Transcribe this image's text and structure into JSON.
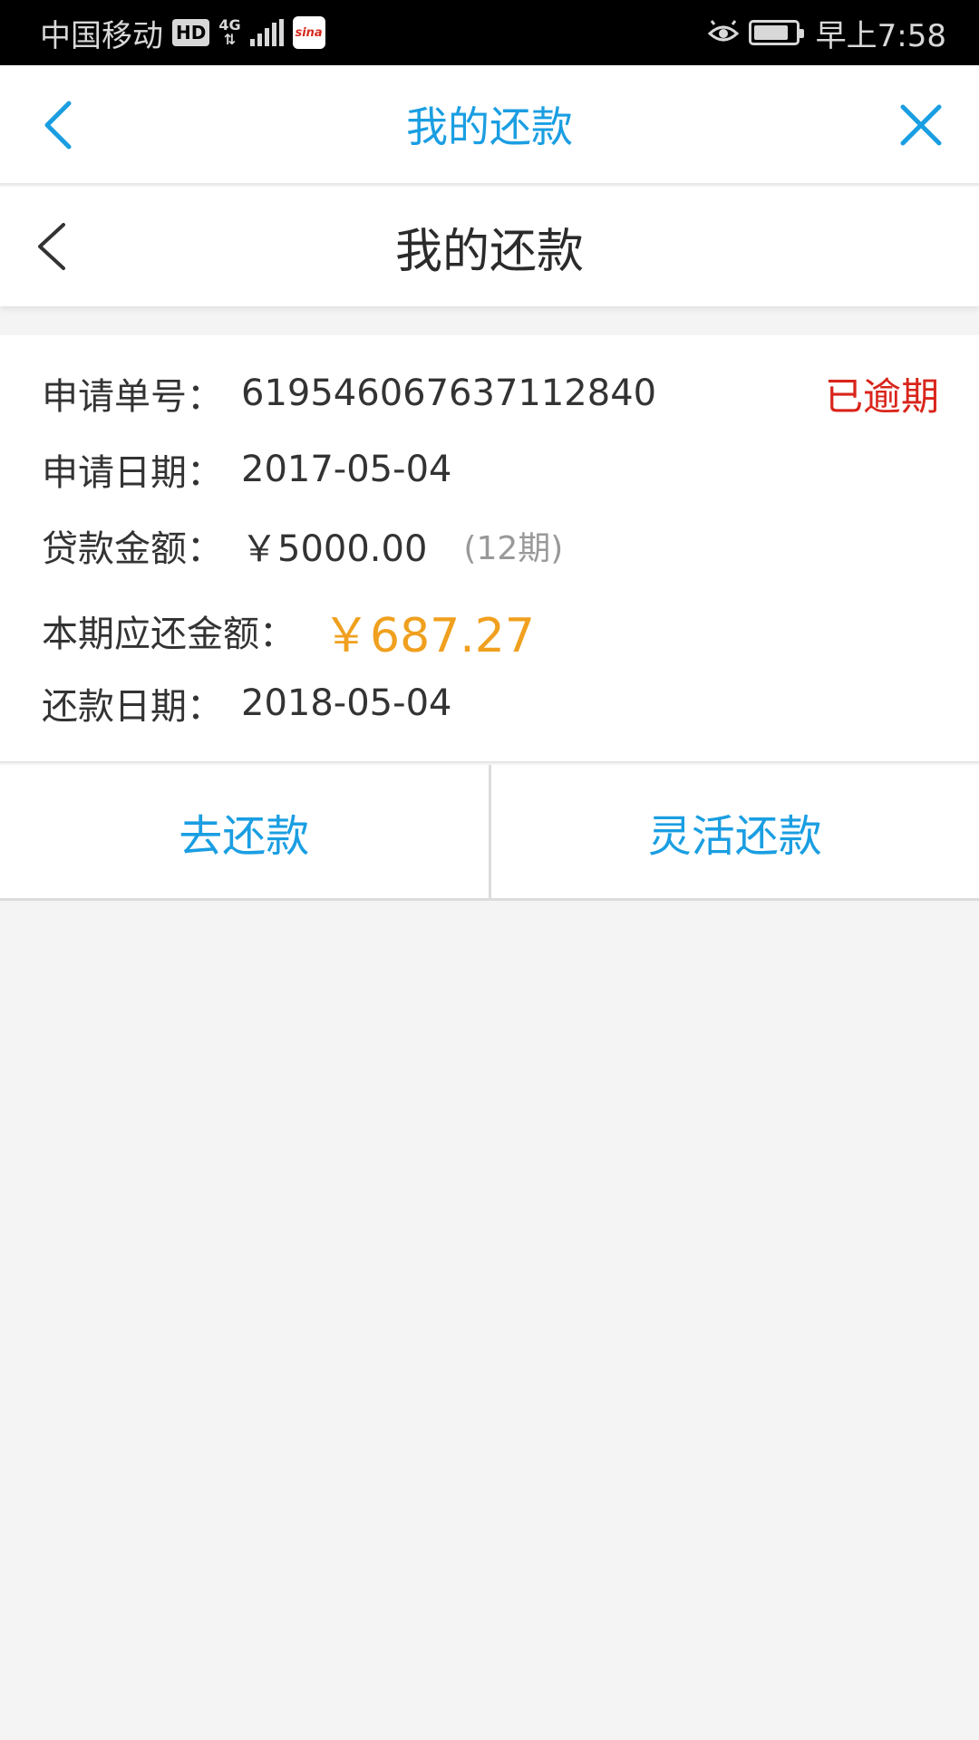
{
  "status_bar": {
    "carrier": "中国移动",
    "hd_badge": "HD",
    "network": "4G",
    "app_badge": "sina",
    "time": "早上7:58"
  },
  "top_nav": {
    "title": "我的还款",
    "back_icon": "chevron-left-icon",
    "close_icon": "close-icon",
    "accent_color": "#1a9ee2"
  },
  "sub_nav": {
    "title": "我的还款",
    "back_icon": "chevron-left-icon"
  },
  "loan": {
    "application_no_label": "申请单号：",
    "application_no": "619546067637112840",
    "status": "已逾期",
    "status_color": "#d9241b",
    "application_date_label": "申请日期：",
    "application_date": "2017-05-04",
    "loan_amount_label": "贷款金额：",
    "loan_amount": "￥5000.00",
    "periods": "(12期)",
    "amount_due_label": "本期应还金额：",
    "amount_due": "￥687.27",
    "amount_due_color": "#f0a01e",
    "repayment_date_label": "还款日期：",
    "repayment_date": "2018-05-04"
  },
  "actions": {
    "repay_label": "去还款",
    "flexible_repay_label": "灵活还款"
  }
}
